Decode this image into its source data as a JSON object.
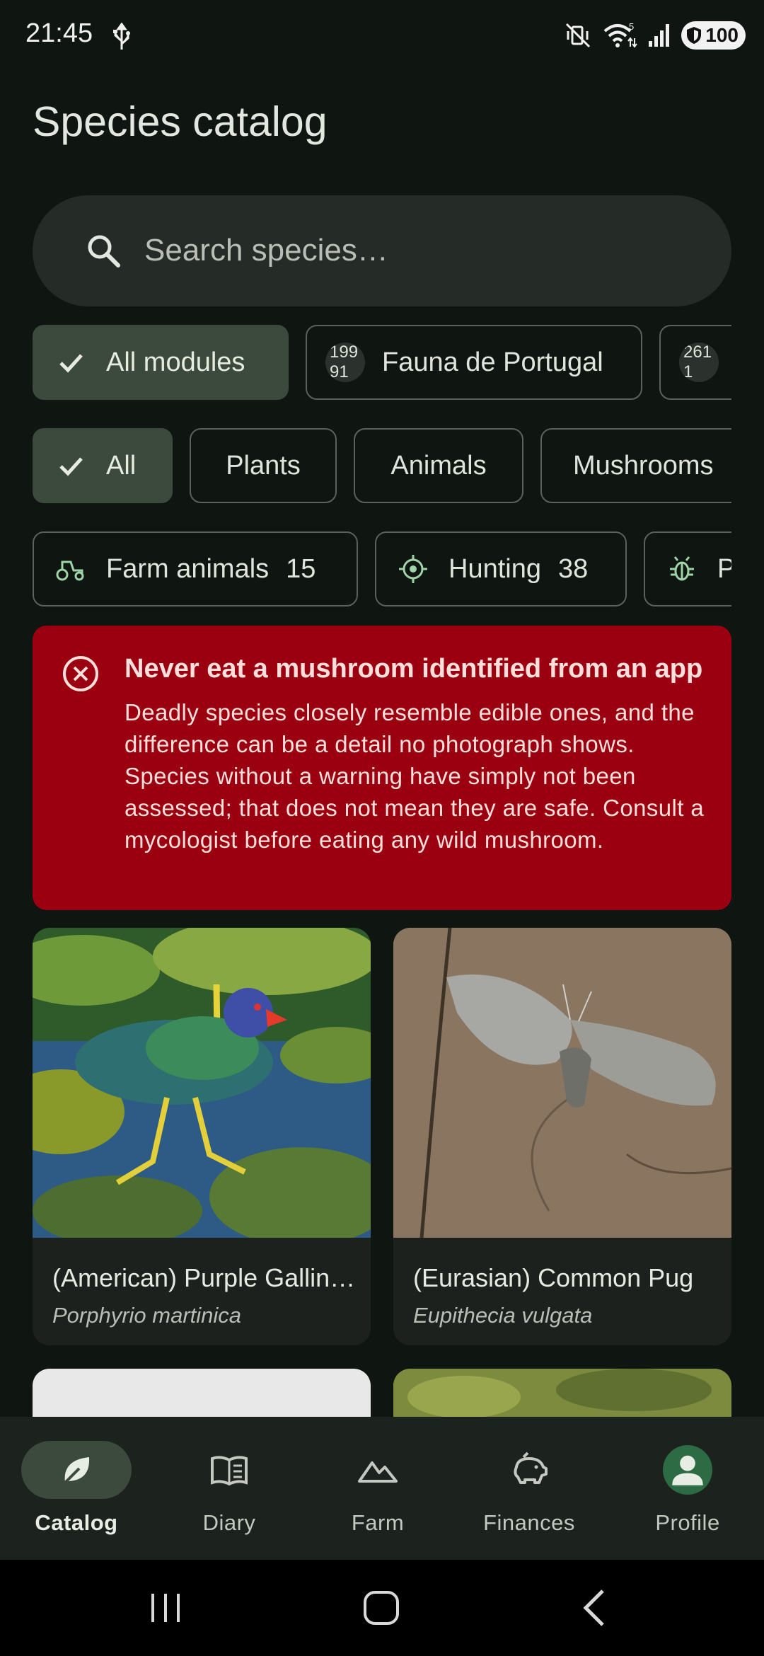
{
  "status_bar": {
    "time": "21:45",
    "battery": "100",
    "wifi_badge": "5",
    "icons": [
      "usb-icon",
      "mute-vibrate-icon",
      "wifi-icon",
      "signal-icon",
      "battery-icon"
    ]
  },
  "header": {
    "title": "Species catalog"
  },
  "search": {
    "placeholder": "Search species…",
    "value": ""
  },
  "module_chips": [
    {
      "label": "All modules",
      "selected": true
    },
    {
      "label": "Fauna de Portugal",
      "badge_top": "199",
      "badge_bottom": "91",
      "selected": false
    },
    {
      "label": "",
      "badge_top": "261",
      "badge_bottom": "1",
      "selected": false
    }
  ],
  "category_chips": [
    {
      "label": "All",
      "selected": true
    },
    {
      "label": "Plants",
      "selected": false
    },
    {
      "label": "Animals",
      "selected": false
    },
    {
      "label": "Mushrooms",
      "selected": false
    }
  ],
  "tag_chips": [
    {
      "label": "Farm animals",
      "count": "15",
      "icon": "tractor-icon"
    },
    {
      "label": "Hunting",
      "count": "38",
      "icon": "crosshair-icon"
    },
    {
      "label": "P",
      "count": "",
      "icon": "bug-icon"
    }
  ],
  "warning": {
    "title": "Never eat a mushroom identified from an app",
    "body": "Deadly species closely resemble edible ones, and the difference can be a detail no photograph shows. Species without a warning have simply not been assessed; that does not mean they are safe. Consult a mycologist before eating any wild mushroom."
  },
  "species": [
    {
      "common_name": "(American) Purple Gallinule",
      "latin_name": "Porphyrio martinica"
    },
    {
      "common_name": "(Eurasian) Common Pug",
      "latin_name": "Eupithecia vulgata"
    }
  ],
  "bottom_nav": [
    {
      "label": "Catalog",
      "icon": "leaf-icon",
      "active": true
    },
    {
      "label": "Diary",
      "icon": "book-icon",
      "active": false
    },
    {
      "label": "Farm",
      "icon": "landscape-icon",
      "active": false
    },
    {
      "label": "Finances",
      "icon": "piggy-bank-icon",
      "active": false
    },
    {
      "label": "Profile",
      "icon": "person-icon",
      "active": false
    }
  ],
  "colors": {
    "background": "#0f1511",
    "selected_chip": "#3b4a3c",
    "warning": "#9b0010",
    "avatar": "#2c6b43"
  }
}
